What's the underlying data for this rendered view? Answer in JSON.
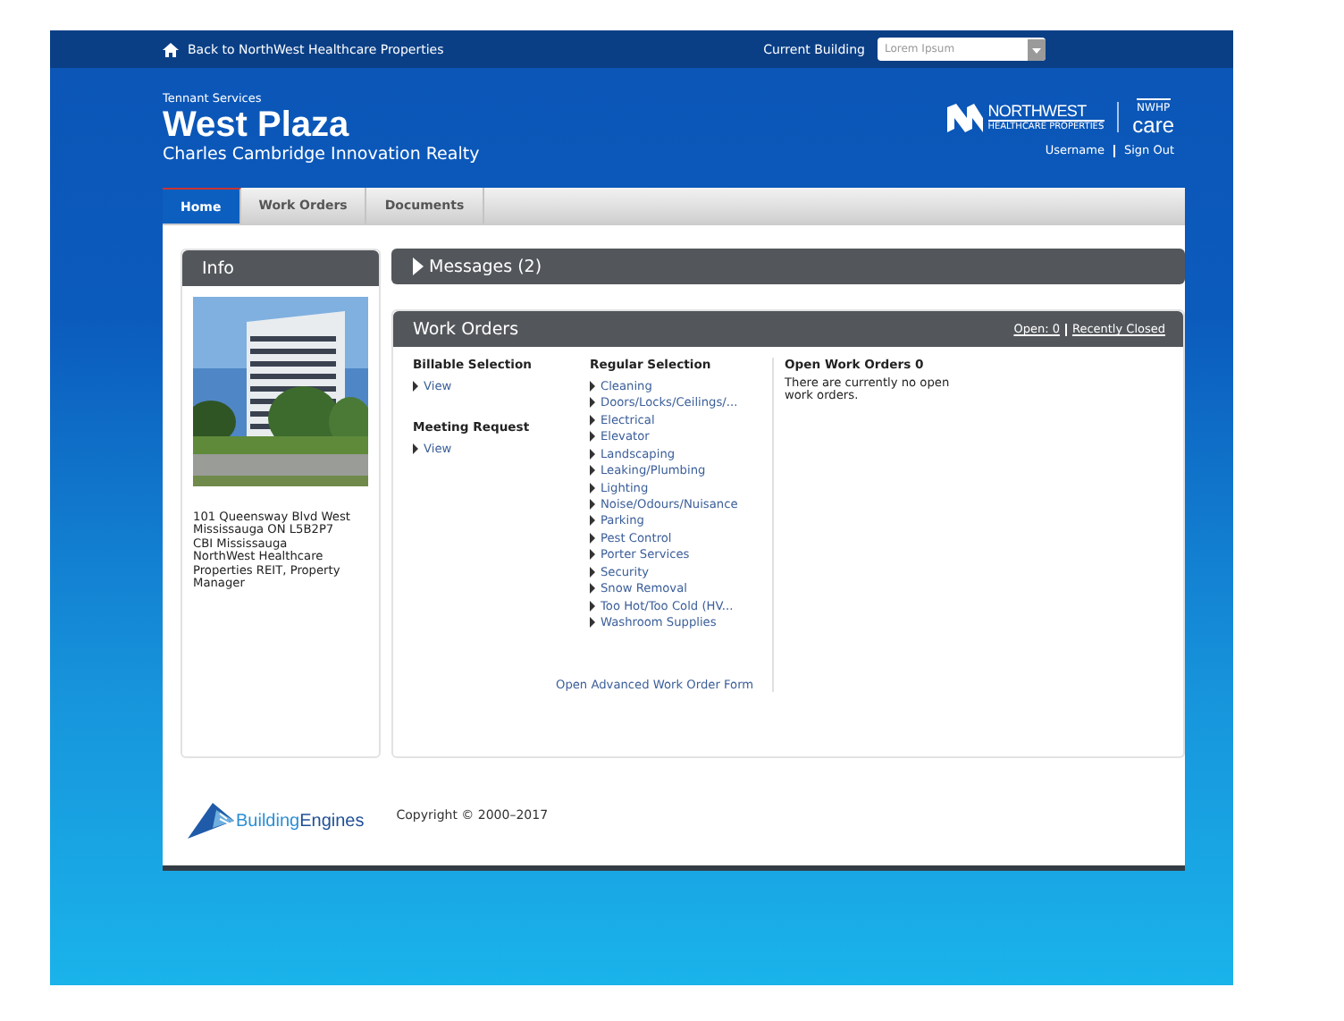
{
  "top_bar": {
    "back_link": "Back to NorthWest Healthcare Properties",
    "building_label": "Current Building",
    "building_select": {
      "value": "Lorem Ipsum"
    }
  },
  "header": {
    "eyebrow": "Tennant Services",
    "title": "West Plaza",
    "subtitle": "Charles Cambridge Innovation Realty",
    "logo": {
      "name": "NORTHWEST",
      "tagline": "HEALTHCARE PROPERTIES"
    },
    "care_logo": {
      "top": "NWHP",
      "bottom": "care"
    },
    "user_links": [
      "Username",
      "Sign Out"
    ]
  },
  "tabs": [
    {
      "label": "Home",
      "selected": true
    },
    {
      "label": "Work Orders",
      "selected": false
    },
    {
      "label": "Documents",
      "selected": false
    }
  ],
  "info": {
    "title": "Info",
    "address": [
      "101 Queensway Blvd West",
      "Mississauga ON L5B2P7",
      "CBI Mississauga",
      "NorthWest Healthcare Properties REIT, Property Manager"
    ]
  },
  "messages": {
    "title": "Messages (2)",
    "expanded": false
  },
  "work_orders": {
    "title": "Work Orders",
    "header_links": [
      "Open: 0",
      "Recently Closed"
    ],
    "groups": [
      {
        "title": "Billable Selection",
        "links": [
          "View"
        ]
      },
      {
        "title": "Meeting Request",
        "links": [
          "View"
        ]
      }
    ],
    "regular": {
      "title": "Regular Selection",
      "links": [
        "Cleaning",
        "Doors/Locks/Ceilings/...",
        "Electrical",
        "Elevator",
        "Landscaping",
        "Leaking/Plumbing",
        "Lighting",
        "Noise/Odours/Nuisance",
        "Parking",
        "Pest Control",
        "Porter Services",
        "Security",
        "Snow Removal",
        "Too Hot/Too Cold (HV...",
        "Washroom Supplies"
      ]
    },
    "advanced_link": "Open Advanced Work Order Form",
    "open": {
      "title": "Open Work Orders 0",
      "message": "There are currently no open work orders."
    }
  },
  "footer": {
    "logo": {
      "part1": "Building",
      "part2": "Engines"
    },
    "copyright": "Copyright © 2000–2017"
  }
}
